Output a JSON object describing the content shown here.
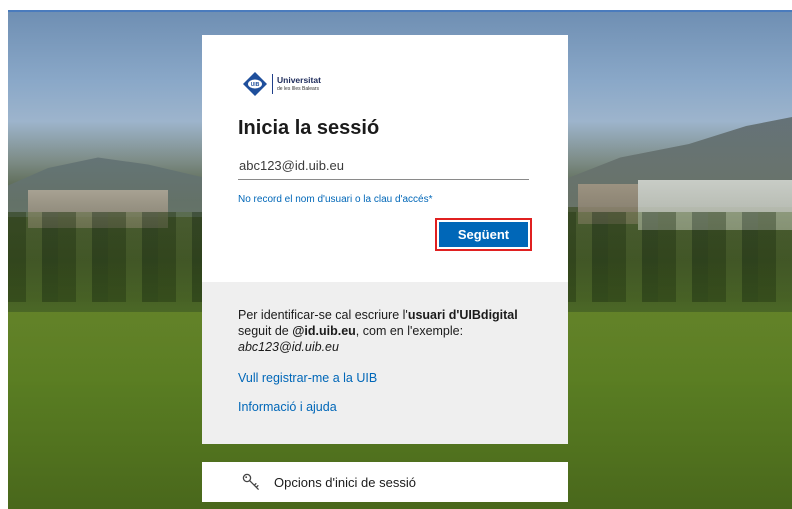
{
  "logo": {
    "mark_text": "UIB",
    "name": "Universitat",
    "subtitle": "de les Illes Balears"
  },
  "signin": {
    "title": "Inicia la sessió",
    "username_value": "abc123@id.uib.eu",
    "forgot_link": "No record el nom d'usuari o la clau d'accés*",
    "next_button": "Següent"
  },
  "info": {
    "text_part1": "Per identificar-se cal escriure l'",
    "text_bold1": "usuari d'UIBdigital",
    "text_part2": " seguit de ",
    "text_bold2": "@id.uib.eu",
    "text_part3": ", com en l'exemple: ",
    "text_example": "abc123@id.uib.eu",
    "register_link": "Vull registrar-me a la UIB",
    "help_link": "Informació i ajuda"
  },
  "options": {
    "label": "Opcions d'inici de sessió",
    "icon": "key-icon"
  },
  "colors": {
    "accent": "#0067b8",
    "highlight_border": "#e02020",
    "info_bg": "#efefef"
  }
}
